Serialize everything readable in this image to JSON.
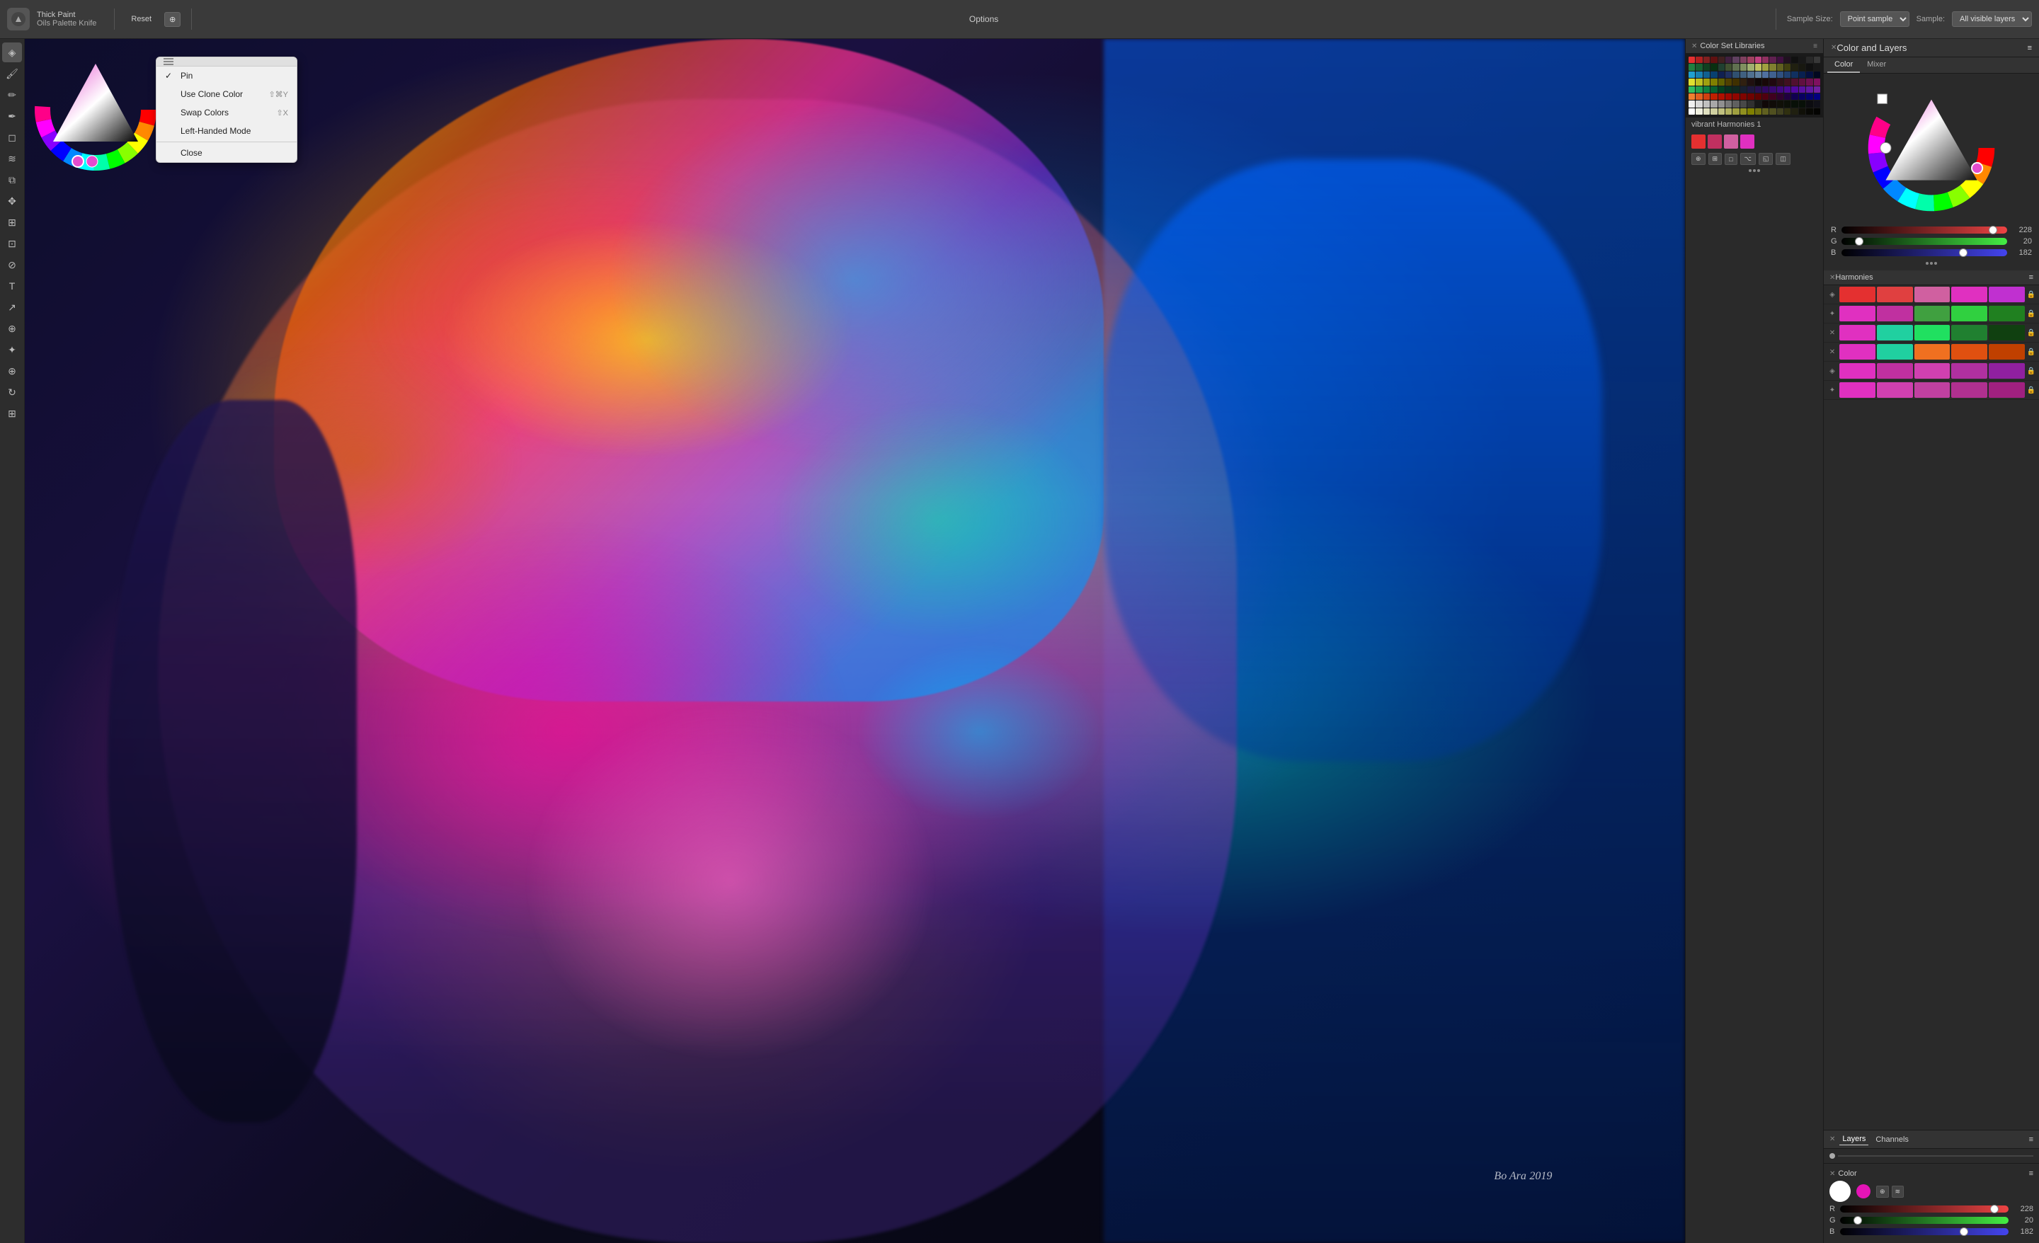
{
  "toolbar": {
    "app_icon": "✦",
    "brush_name": "Thick Paint",
    "brush_sub": "Oils Palette Knife",
    "reset_label": "Reset",
    "options_label": "Options",
    "sample_size_label": "Sample Size:",
    "sample_size_value": "Point sample",
    "sample_label": "Sample:",
    "sample_value": "All visible layers",
    "clone_icon": "⊕"
  },
  "context_menu": {
    "pin_label": "Pin",
    "use_clone_label": "Use Clone Color",
    "use_clone_shortcut": "⇧⌘Y",
    "swap_label": "Swap Colors",
    "swap_shortcut": "⇧X",
    "left_hand_label": "Left-Handed Mode",
    "close_label": "Close"
  },
  "right_header": {
    "title": "Color and Layers"
  },
  "color_set": {
    "title": "Color Set Libraries",
    "harmonies_label": "vibrant Harmonies 1"
  },
  "color_tabs": {
    "color_label": "Color",
    "mixer_label": "Mixer"
  },
  "rgb": {
    "r_label": "R",
    "g_label": "G",
    "b_label": "B",
    "r_value": "228",
    "g_value": "20",
    "b_value": "182",
    "r_pct": 89,
    "g_pct": 8,
    "b_pct": 71
  },
  "harmonies": {
    "title": "Harmonies",
    "rows": [
      {
        "colors": [
          "#e43030",
          "#e04040",
          "#d060a0",
          "#e030c0",
          "#c030d0"
        ],
        "locked": true
      },
      {
        "colors": [
          "#e030c0",
          "#c030a0",
          "#40a040",
          "#30d040",
          "#208020"
        ],
        "locked": true
      },
      {
        "colors": [
          "#e030c0",
          "#20d0a0",
          "#20e060",
          "#208030",
          "#104010"
        ],
        "locked": true
      },
      {
        "colors": [
          "#e030c0",
          "#20d0a0",
          "#f07020",
          "#e05010",
          "#c04000"
        ],
        "locked": true
      },
      {
        "colors": [
          "#e030c0",
          "#c030a0",
          "#d040b0",
          "#b030a0",
          "#9020a0"
        ],
        "locked": true
      },
      {
        "colors": [
          "#e030c0",
          "#d040b0",
          "#c040a0",
          "#b03090",
          "#a02080"
        ],
        "locked": true
      }
    ]
  },
  "layers": {
    "title": "Layers",
    "channels_label": "Channels"
  },
  "bottom_color": {
    "title": "Color",
    "r_label": "R",
    "g_label": "G",
    "b_label": "B",
    "r_value": "228",
    "g_value": "20",
    "b_value": "182",
    "r_pct": 89,
    "g_pct": 8,
    "b_pct": 71
  },
  "signature": "Bo Ara",
  "year": "2019",
  "tools": [
    "✦",
    "🖌",
    "✏",
    "🖊",
    "✒",
    "📐",
    "🔵",
    "○",
    "⬜",
    "🔺",
    "🔠",
    "↗",
    "⊕",
    "🔍",
    "↻",
    "⊞"
  ],
  "color_swatches": [
    [
      "#e53030",
      "#b02020",
      "#802020",
      "#601010",
      "#402020",
      "#402040",
      "#604060",
      "#804060",
      "#a04060",
      "#c04080",
      "#903060",
      "#602050",
      "#401040",
      "#201020",
      "#101010",
      "#181818",
      "#282828",
      "#383838"
    ],
    [
      "#208040",
      "#186030",
      "#104020",
      "#083010",
      "#204030",
      "#405030",
      "#607050",
      "#809060",
      "#a0b070",
      "#c0c060",
      "#a0a040",
      "#808030",
      "#606020",
      "#404010",
      "#202010",
      "#181810",
      "#101010",
      "#181818"
    ],
    [
      "#20a0d0",
      "#1880b0",
      "#106090",
      "#084070",
      "#102050",
      "#203060",
      "#305070",
      "#406080",
      "#507090",
      "#6080a0",
      "#5070a0",
      "#406090",
      "#305080",
      "#204070",
      "#103060",
      "#082050",
      "#041040",
      "#020820"
    ],
    [
      "#e0e030",
      "#c0c020",
      "#a0a010",
      "#808000",
      "#606000",
      "#504000",
      "#403000",
      "#302010",
      "#201010",
      "#100808",
      "#180808",
      "#200810",
      "#301018",
      "#401020",
      "#501030",
      "#601040",
      "#701050",
      "#801060"
    ],
    [
      "#30c060",
      "#20a050",
      "#108040",
      "#086030",
      "#044020",
      "#083020",
      "#102820",
      "#182030",
      "#201840",
      "#281050",
      "#300860",
      "#380870",
      "#400880",
      "#480890",
      "#5008a0",
      "#5810a0",
      "#6018a0",
      "#7020a0"
    ],
    [
      "#f08030",
      "#e06020",
      "#d04010",
      "#c02000",
      "#b01000",
      "#a00800",
      "#900600",
      "#800400",
      "#700200",
      "#600100",
      "#500010",
      "#400020",
      "#300030",
      "#200040",
      "#100050",
      "#080060",
      "#040070",
      "#020080"
    ],
    [
      "#f0f0f0",
      "#d8d8d8",
      "#c0c0c0",
      "#a8a8a8",
      "#909090",
      "#787878",
      "#606060",
      "#484848",
      "#303030",
      "#181818",
      "#100808",
      "#100c08",
      "#101008",
      "#0c1008",
      "#081008",
      "#081008",
      "#0c0c10",
      "#101018"
    ],
    [
      "#ffffff",
      "#f0f0e0",
      "#e0e0c0",
      "#d0d0a0",
      "#c0c080",
      "#b0b060",
      "#a0a040",
      "#909020",
      "#808000",
      "#707010",
      "#606020",
      "#505020",
      "#404020",
      "#303010",
      "#202010",
      "#101008",
      "#080804",
      "#040402"
    ]
  ]
}
